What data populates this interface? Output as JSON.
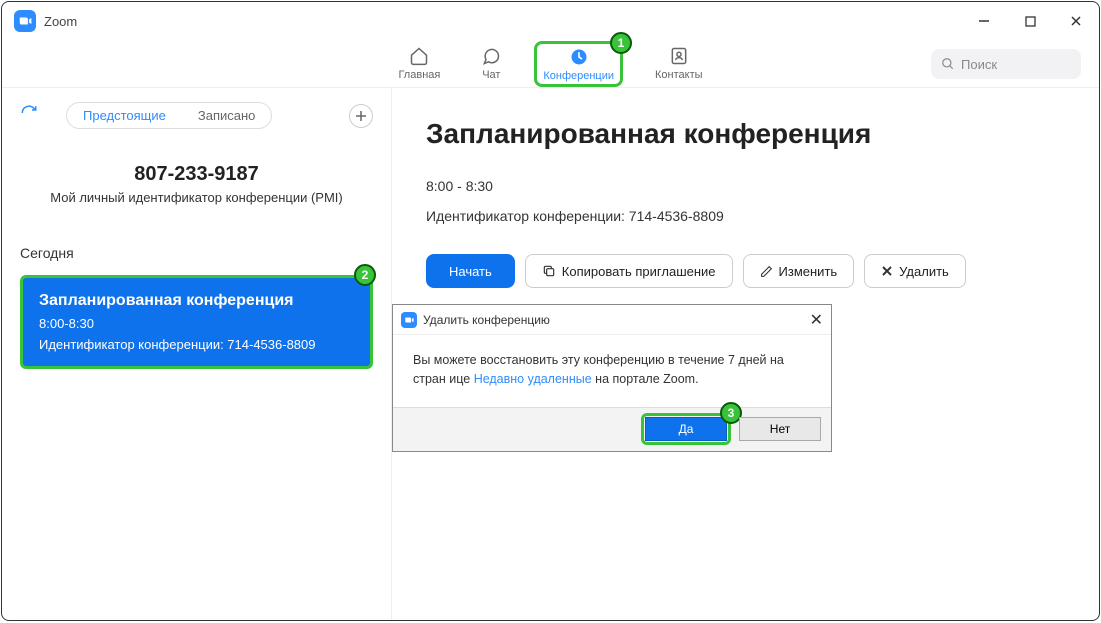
{
  "window": {
    "title": "Zoom"
  },
  "nav": {
    "home": "Главная",
    "chat": "Чат",
    "meetings": "Конференции",
    "contacts": "Контакты",
    "search_placeholder": "Поиск"
  },
  "annotations": {
    "step1": "1",
    "step2": "2",
    "step3": "3"
  },
  "sidebar": {
    "tabs": {
      "upcoming": "Предстоящие",
      "recorded": "Записано"
    },
    "pmi_number": "807-233-9187",
    "pmi_label": "Мой личный идентификатор конференции (PMI)",
    "today": "Сегодня",
    "card": {
      "title": "Запланированная конференция",
      "time": "8:00-8:30",
      "id_label": "Идентификатор конференции: 714-4536-8809"
    }
  },
  "detail": {
    "title": "Запланированная конференция",
    "time": "8:00 - 8:30",
    "id_label": "Идентификатор конференции: 714-4536-8809",
    "buttons": {
      "start": "Начать",
      "copy": "Копировать приглашение",
      "edit": "Изменить",
      "delete": "Удалить"
    }
  },
  "dialog": {
    "title": "Удалить конференцию",
    "body_pre": "Вы можете восстановить эту конференцию в течение 7 дней на стран ице ",
    "body_link": "Недавно удаленные",
    "body_post": " на портале Zoom.",
    "yes": "Да",
    "no": "Нет"
  }
}
